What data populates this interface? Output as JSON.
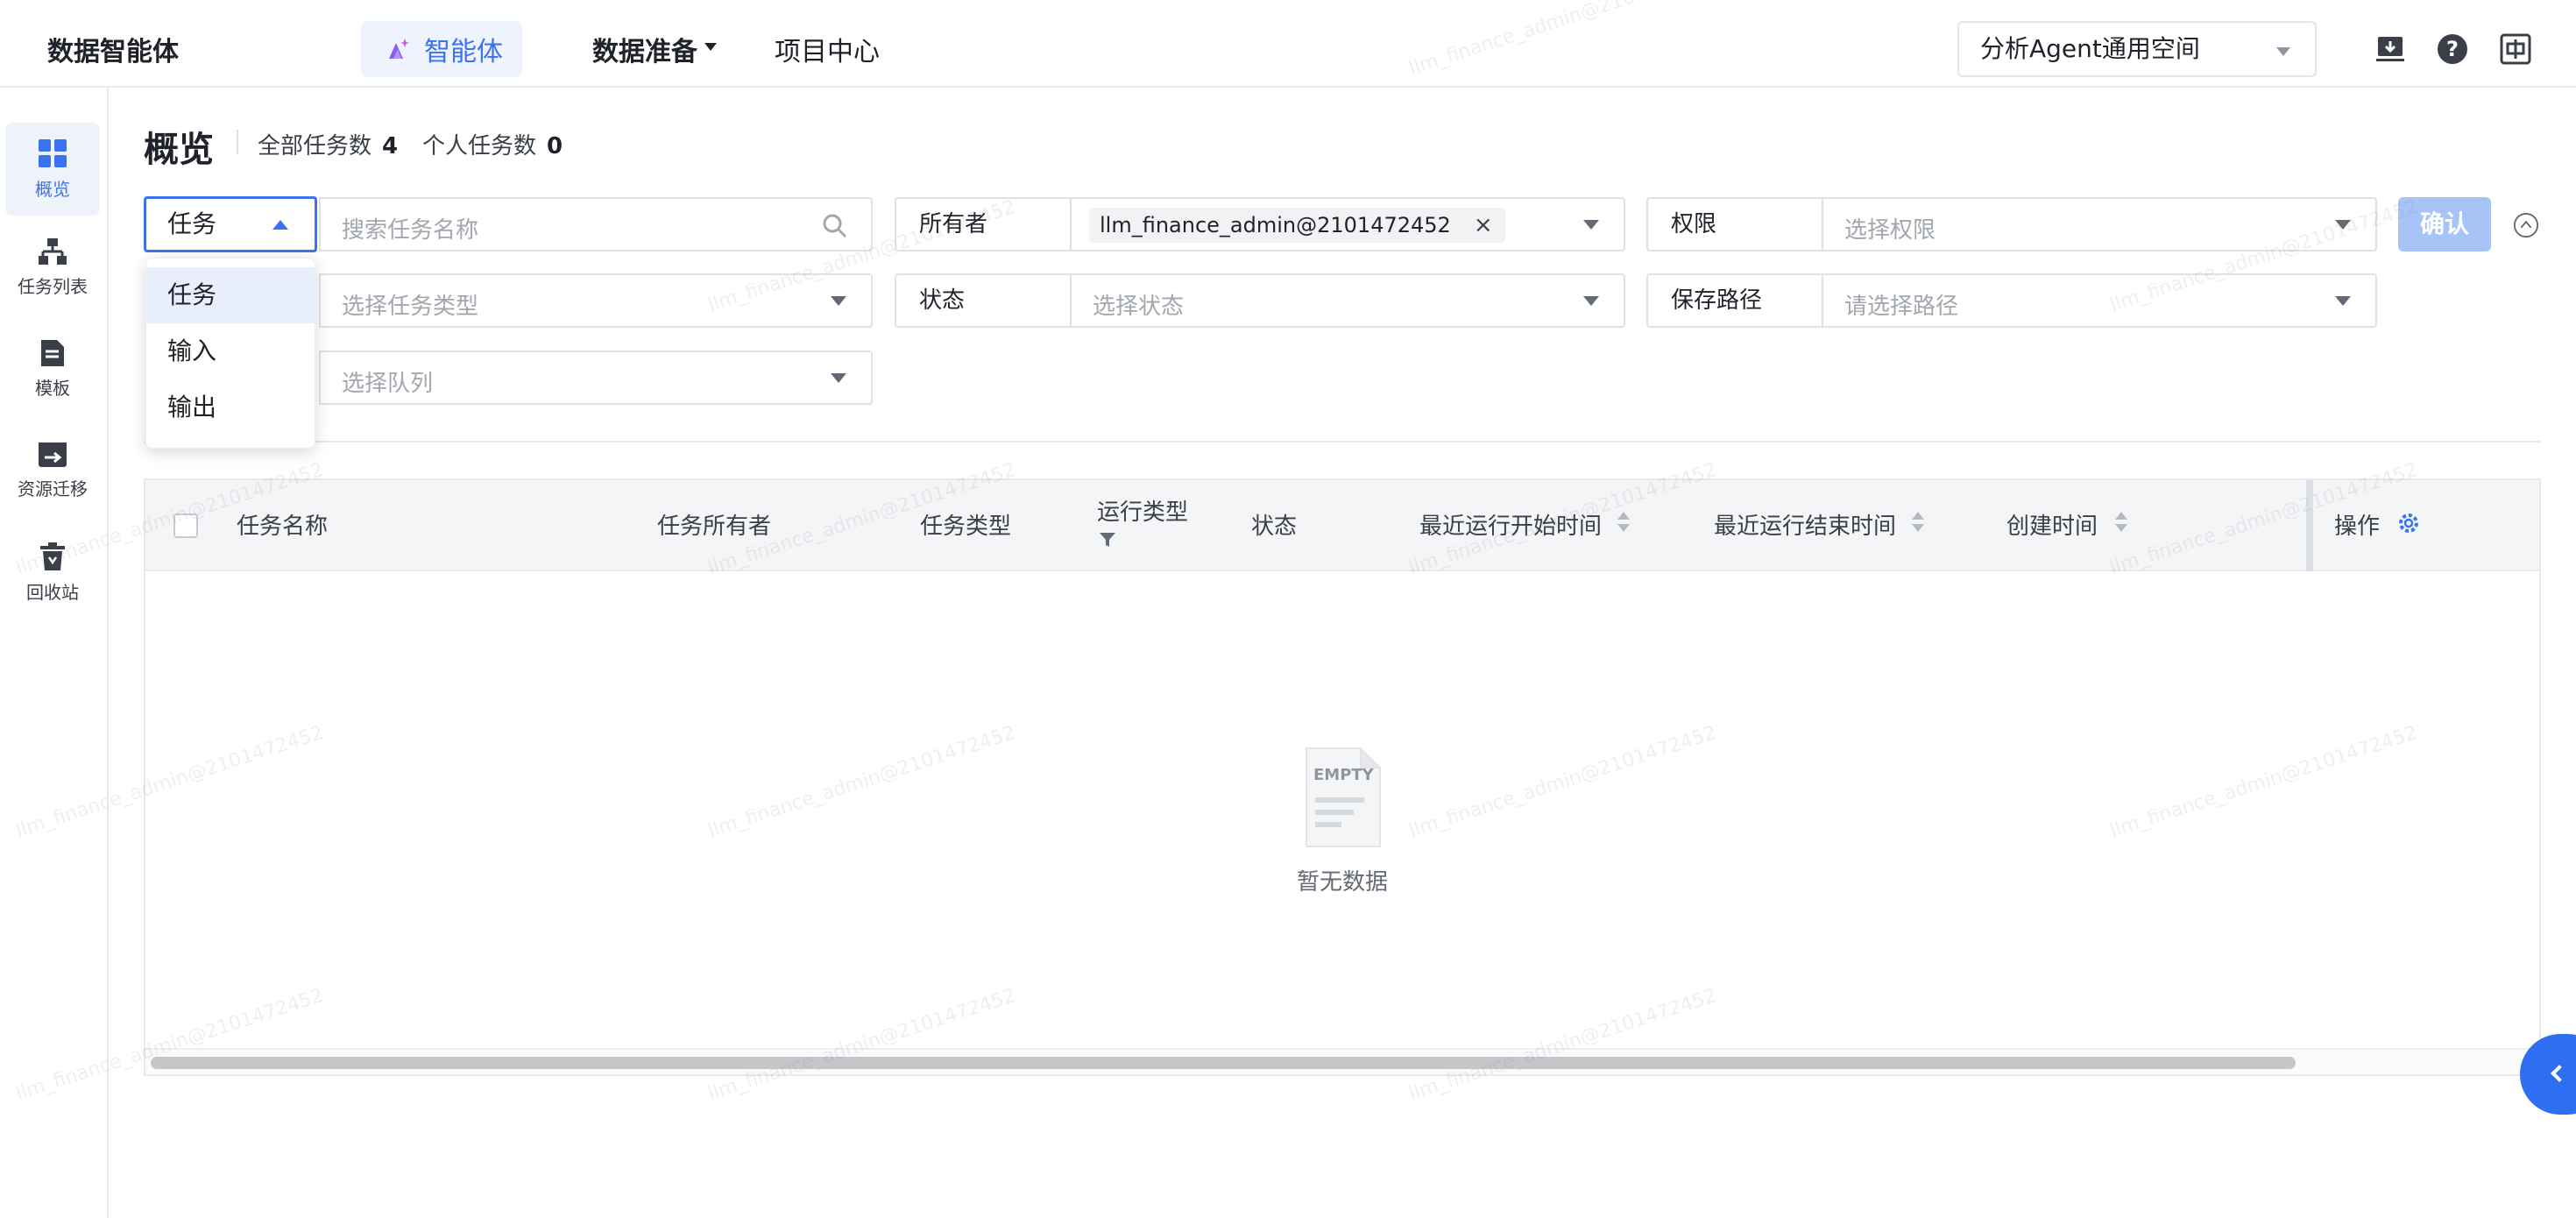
{
  "topbar": {
    "brand": "数据智能体",
    "nav_agent": "智能体",
    "nav_prep": "数据准备",
    "nav_project": "项目中心",
    "workspace": "分析Agent通用空间"
  },
  "sidebar": {
    "items": [
      {
        "label": "概览",
        "icon": "overview-grid-icon",
        "active": true
      },
      {
        "label": "任务列表",
        "icon": "task-tree-icon"
      },
      {
        "label": "模板",
        "icon": "template-icon"
      },
      {
        "label": "资源迁移",
        "icon": "migration-icon"
      },
      {
        "label": "回收站",
        "icon": "recycle-bin-icon"
      }
    ]
  },
  "header": {
    "title": "概览",
    "all_tasks_label": "全部任务数",
    "all_tasks_count": "4",
    "personal_tasks_label": "个人任务数",
    "personal_tasks_count": "0"
  },
  "filters": {
    "type_select_value": "任务",
    "search_placeholder": "搜索任务名称",
    "owner_label": "所有者",
    "owner_tag": "llm_finance_admin@2101472452",
    "permission_label": "权限",
    "permission_placeholder": "选择权限",
    "task_type_placeholder": "选择任务类型",
    "status_label": "状态",
    "status_placeholder": "选择状态",
    "save_path_label": "保存路径",
    "save_path_placeholder": "请选择路径",
    "queue_placeholder": "选择队列",
    "confirm_label": "确认"
  },
  "dropdown": {
    "options": [
      "任务",
      "输入",
      "输出"
    ],
    "selected": "任务"
  },
  "table": {
    "columns": [
      "任务名称",
      "任务所有者",
      "任务类型",
      "运行类型",
      "状态",
      "最近运行开始时间",
      "最近运行结束时间",
      "创建时间",
      "操作"
    ],
    "empty_badge": "EMPTY",
    "empty_text": "暂无数据"
  },
  "watermark": "llm_finance_admin@2101472452",
  "colors": {
    "accent": "#3b72f0",
    "confirm_disabled": "#a7c4f7",
    "float_button": "#2e6ff2"
  }
}
